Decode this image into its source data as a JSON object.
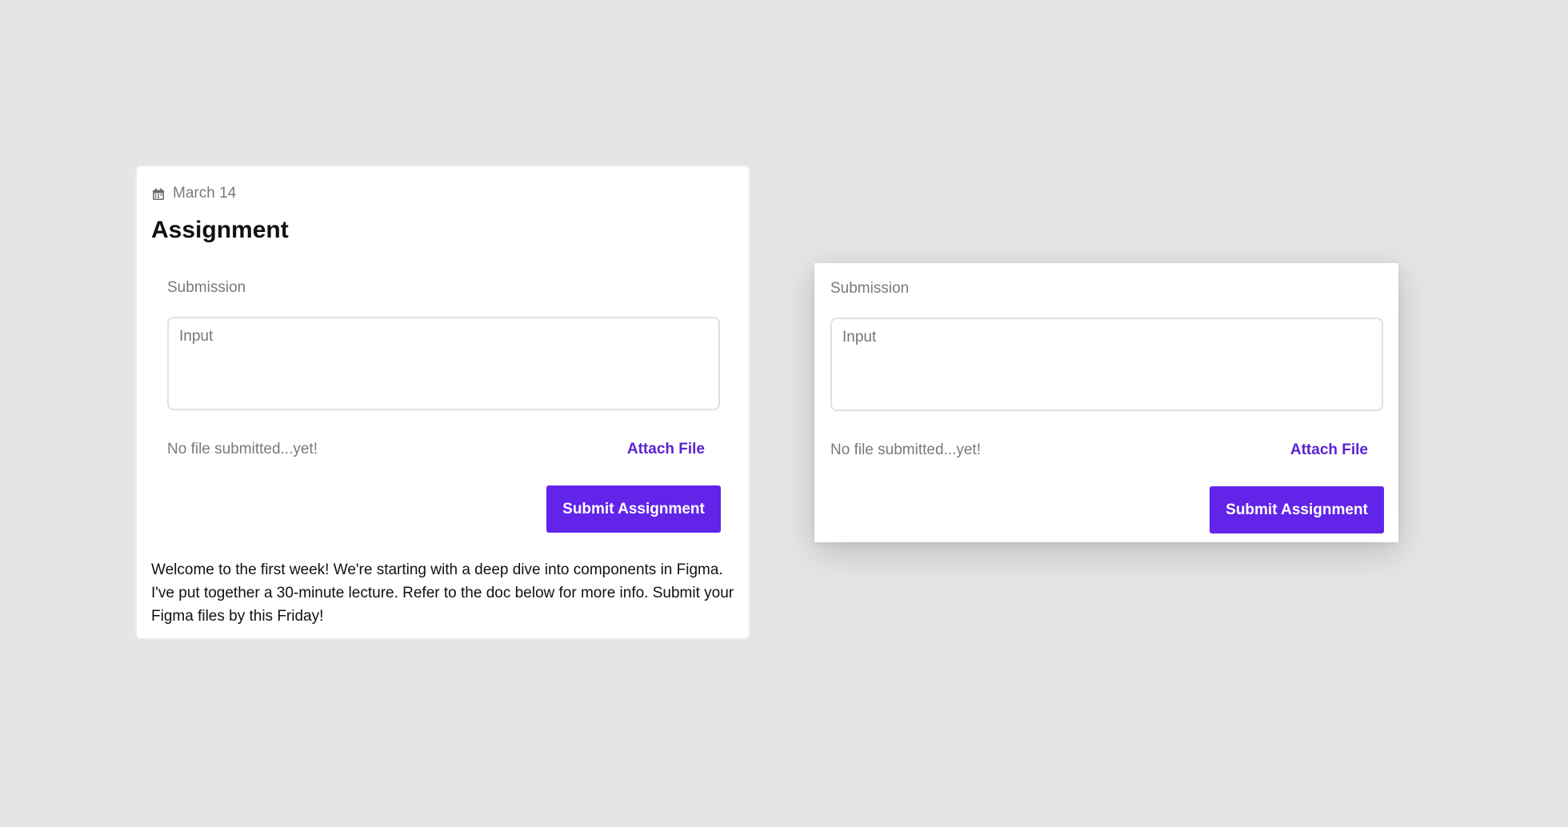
{
  "assignment_card": {
    "date": "March 14",
    "calendar_icon": "calendar-icon",
    "title": "Assignment",
    "submission_label": "Submission",
    "input_placeholder": "Input",
    "file_status": "No file submitted...yet!",
    "attach_label": "Attach File",
    "submit_label": "Submit Assignment",
    "description": "Welcome to the first week! We're starting with a deep dive into components in Figma. I've put together a 30-minute lecture. Refer to the doc below for more info. Submit your Figma files by this Friday!"
  },
  "submission_component": {
    "submission_label": "Submission",
    "input_placeholder": "Input",
    "file_status": "No file submitted...yet!",
    "attach_label": "Attach File",
    "submit_label": "Submit Assignment"
  },
  "colors": {
    "background": "#e5e5e5",
    "accent": "#6224e9",
    "link": "#5b21d4",
    "muted_text": "#7a7a7a"
  }
}
